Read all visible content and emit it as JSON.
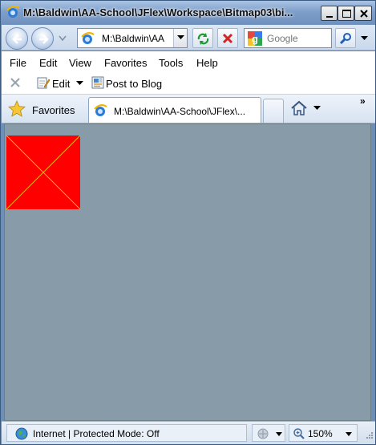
{
  "window": {
    "title": "M:\\Baldwin\\AA-School\\JFlex\\Workspace\\Bitmap03\\bi..."
  },
  "navigation": {
    "address": "M:\\Baldwin\\AA",
    "search_placeholder": "Google"
  },
  "menu": {
    "items": [
      "File",
      "Edit",
      "View",
      "Favorites",
      "Tools",
      "Help"
    ]
  },
  "commandbar": {
    "edit_label": "Edit",
    "blog_label": "Post to Blog"
  },
  "favorites_bar": {
    "favorites_label": "Favorites",
    "tab_title": "M:\\Baldwin\\AA-School\\JFlex\\...",
    "overflow": "»"
  },
  "content": {
    "background_color": "#879ca8",
    "bitmap": {
      "fill_color": "#ff0000",
      "line_color": "#ffd700"
    }
  },
  "statusbar": {
    "zone_text": "Internet | Protected Mode: Off",
    "zoom": "150%"
  }
}
